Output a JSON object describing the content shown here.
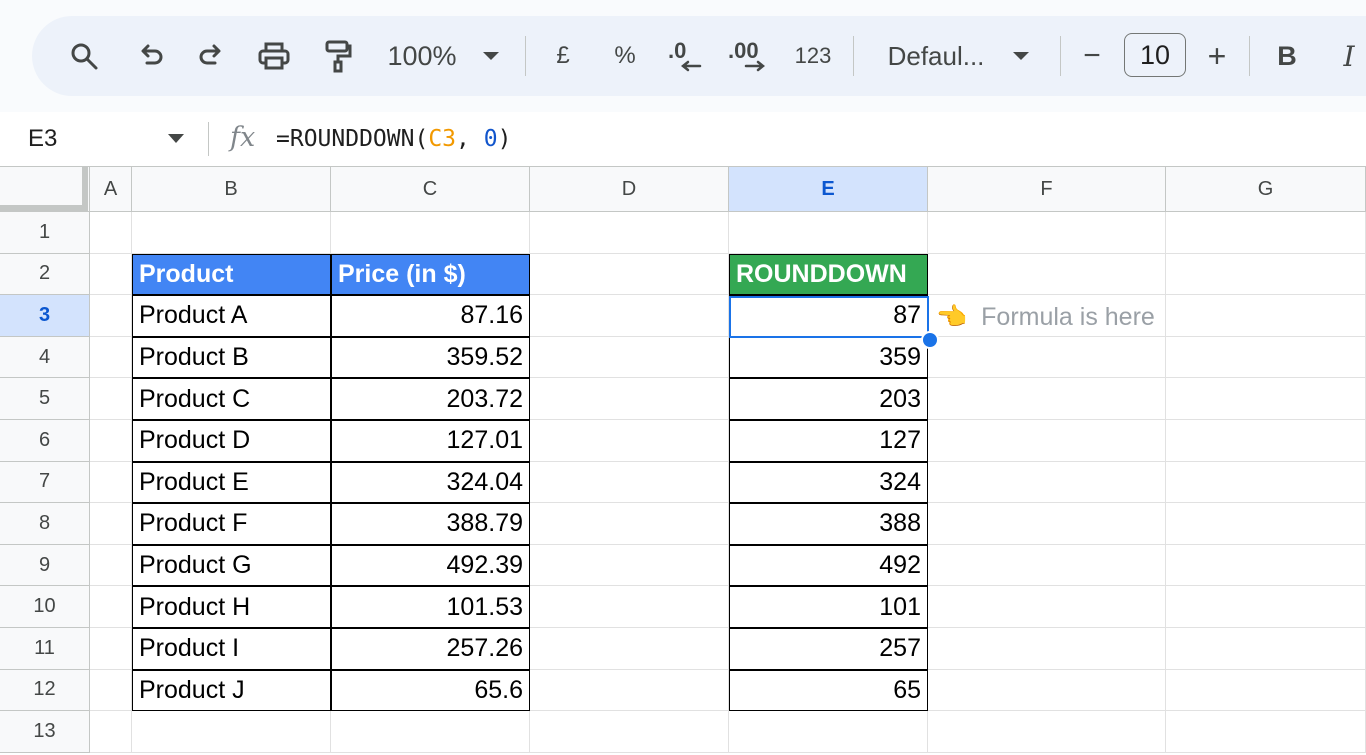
{
  "toolbar": {
    "zoom": "100%",
    "currency_label": "£",
    "percent_label": "%",
    "decrease_decimal_label": ".0",
    "increase_decimal_label": ".00",
    "number_format_label": "123",
    "font_family": "Defaul...",
    "font_size": "10",
    "minus_label": "−",
    "plus_label": "+",
    "bold_label": "B",
    "italic_label": "I"
  },
  "formula_bar": {
    "name_box": "E3",
    "fx_label": "fx",
    "formula_prefix": "=ROUNDDOWN(",
    "formula_ref": "C3",
    "formula_sep": ", ",
    "formula_arg": "0",
    "formula_suffix": ")"
  },
  "columns": [
    "A",
    "B",
    "C",
    "D",
    "E",
    "F",
    "G"
  ],
  "rows": [
    "1",
    "2",
    "3",
    "4",
    "5",
    "6",
    "7",
    "8",
    "9",
    "10",
    "11",
    "12",
    "13"
  ],
  "table": {
    "header_product": "Product",
    "header_price": "Price (in $)",
    "header_rounddown": "ROUNDDOWN",
    "products": [
      "Product A",
      "Product B",
      "Product C",
      "Product D",
      "Product E",
      "Product F",
      "Product G",
      "Product H",
      "Product I",
      "Product J"
    ],
    "prices": [
      "87.16",
      "359.52",
      "203.72",
      "127.01",
      "324.04",
      "388.79",
      "492.39",
      "101.53",
      "257.26",
      "65.6"
    ],
    "rounded": [
      "87",
      "359",
      "203",
      "127",
      "324",
      "388",
      "492",
      "101",
      "257",
      "65"
    ]
  },
  "note": {
    "pointer": "👈",
    "text": "Formula is here"
  },
  "colors": {
    "header_blue": "#4285f4",
    "header_green": "#34a853",
    "selection": "#1a73e8"
  }
}
